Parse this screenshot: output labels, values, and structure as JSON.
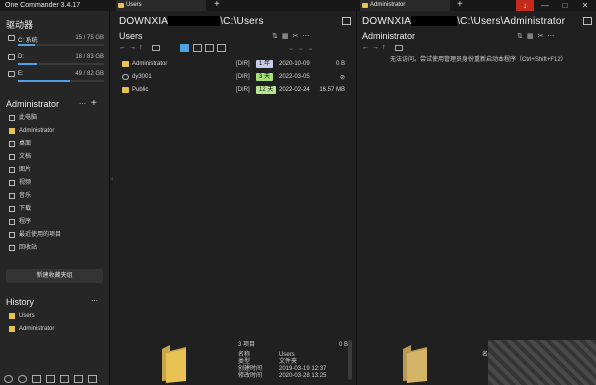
{
  "app": {
    "title": "One Commander 3.4.17"
  },
  "tabs": {
    "left": {
      "label": "Users"
    },
    "right": {
      "label": "Administrator"
    }
  },
  "window": {
    "minimize": "—",
    "maximize": "□",
    "close": "✕",
    "download": "↓"
  },
  "sidebar": {
    "drives_title": "驱动器",
    "drives": [
      {
        "label": "C: 系统",
        "size": "15 / 75 GB",
        "fill": 0.2
      },
      {
        "label": "D:",
        "size": "18 / 83 GB",
        "fill": 0.22
      },
      {
        "label": "E:",
        "size": "49 / 82 GB",
        "fill": 0.6
      }
    ],
    "favorites_title": "Administrator",
    "items": [
      {
        "label": "此电脑",
        "icon": "pc-icon"
      },
      {
        "label": "Administrator",
        "icon": "folder-icon"
      },
      {
        "label": "桌面",
        "icon": "desktop-icon"
      },
      {
        "label": "文档",
        "icon": "document-icon"
      },
      {
        "label": "图片",
        "icon": "picture-icon"
      },
      {
        "label": "视频",
        "icon": "video-icon"
      },
      {
        "label": "音乐",
        "icon": "music-icon"
      },
      {
        "label": "下载",
        "icon": "download-icon"
      },
      {
        "label": "程序",
        "icon": "program-icon"
      },
      {
        "label": "最近使用的项目",
        "icon": "recent-icon"
      },
      {
        "label": "回收站",
        "icon": "recycle-icon"
      }
    ],
    "new_group_label": "新建收藏夹组",
    "history_title": "History",
    "history": [
      {
        "label": "Users"
      },
      {
        "label": "Administrator"
      }
    ]
  },
  "left_pane": {
    "path_prefix": "DOWNXIA",
    "path_suffix": "\\C:\\Users",
    "folder_title": "Users",
    "rows": [
      {
        "name": "Administrator",
        "type": "[DIR]",
        "age": "1 年",
        "age_color": "#c9c9e8",
        "date": "2020-10-09",
        "size": "0 B"
      },
      {
        "name": "dy3001",
        "type": "[DIR]",
        "age": "3 天",
        "age_color": "#a6e07a",
        "date": "2022-03-05",
        "size": "⊘"
      },
      {
        "name": "Public",
        "type": "[DIR]",
        "age": "12 天",
        "age_color": "#b7e68f",
        "date": "2022-02-24",
        "size": "16.57 MB"
      }
    ],
    "item_count": "3 项目",
    "count_size": "0 B",
    "details": [
      {
        "key": "名称",
        "value": "Users"
      },
      {
        "key": "类型",
        "value": "文件夹"
      },
      {
        "key": "创建时间",
        "value": "2019-03-19  12:37"
      },
      {
        "key": "修改时间",
        "value": "2020-03-28  13:25"
      }
    ]
  },
  "right_pane": {
    "path_prefix": "DOWNXIA",
    "path_suffix": "\\C:\\Users\\Administrator",
    "folder_title": "Administrator",
    "message": "无法访问。尝试使用管理员身份重新启动本程序（Ctrl+Shift+F12）",
    "detail_label": "名"
  },
  "colors": {
    "accent": "#4ea1e6",
    "folder": "#e8c354",
    "danger": "#c42b1c"
  }
}
